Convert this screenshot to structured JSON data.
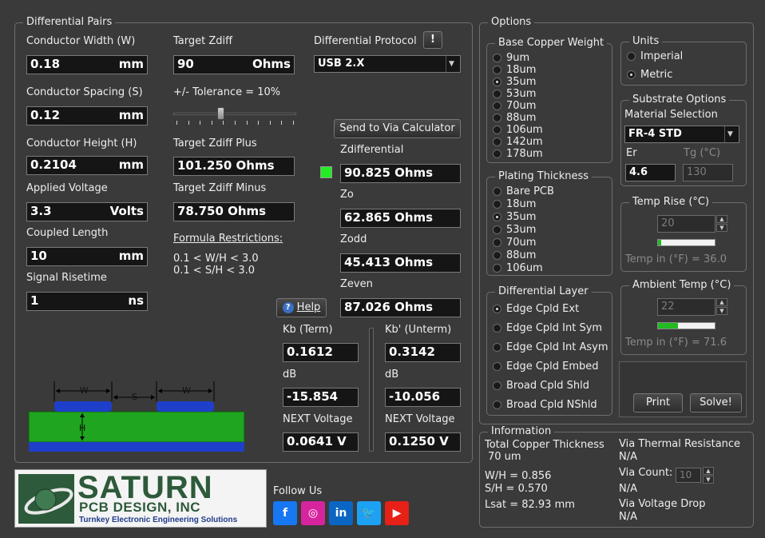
{
  "diff_pairs": {
    "title": "Differential Pairs",
    "conductor_width": {
      "label": "Conductor Width (W)",
      "value": "0.18",
      "unit": "mm"
    },
    "conductor_spacing": {
      "label": "Conductor Spacing (S)",
      "value": "0.12",
      "unit": "mm"
    },
    "conductor_height": {
      "label": "Conductor Height (H)",
      "value": "0.2104",
      "unit": "mm"
    },
    "applied_voltage": {
      "label": "Applied Voltage",
      "value": "3.3",
      "unit": "Volts"
    },
    "coupled_length": {
      "label": "Coupled Length",
      "value": "10",
      "unit": "mm"
    },
    "signal_risetime": {
      "label": "Signal Risetime",
      "value": "1",
      "unit": "ns"
    },
    "target_zdiff": {
      "label": "Target Zdiff",
      "value": "90",
      "unit": "Ohms"
    },
    "tolerance_label": "+/- Tolerance = 10%",
    "tolerance_value": 0.38,
    "target_zdiff_plus": {
      "label": "Target Zdiff Plus",
      "value": "101.250 Ohms"
    },
    "target_zdiff_minus": {
      "label": "Target Zdiff Minus",
      "value": "78.750 Ohms"
    },
    "formula_title": "Formula Restrictions:",
    "formula_line1": "0.1 < W/H < 3.0",
    "formula_line2": "0.1 < S/H < 3.0",
    "protocol_label": "Differential Protocol",
    "protocol_info": "!",
    "protocol_value": "USB 2.X",
    "send_via_label": "Send to Via Calculator",
    "zdifferential": {
      "label": "Zdifferential",
      "value": "90.825 Ohms"
    },
    "zo": {
      "label": "Zo",
      "value": "62.865 Ohms"
    },
    "zodd": {
      "label": "Zodd",
      "value": "45.413 Ohms"
    },
    "zeven": {
      "label": "Zeven",
      "value": "87.026 Ohms"
    },
    "help_label": "Help",
    "help_mark": "?",
    "kb_term": {
      "label": "Kb (Term)",
      "value": "0.1612",
      "db_label": "dB",
      "db": "-15.854",
      "next_label": "NEXT Voltage",
      "next": "0.0641 V"
    },
    "kb_unterm": {
      "label": "Kb' (Unterm)",
      "value": "0.3142",
      "db_label": "dB",
      "db": "-10.056",
      "next_label": "NEXT Voltage",
      "next": "0.1250 V"
    },
    "diagram": {
      "w1": "W",
      "s": "S",
      "w2": "W",
      "h": "H"
    },
    "status_color": "#22ee22"
  },
  "options": {
    "title": "Options",
    "base_copper": {
      "title": "Base Copper Weight",
      "items": [
        "9um",
        "18um",
        "35um",
        "53um",
        "70um",
        "88um",
        "106um",
        "142um",
        "178um"
      ],
      "selected": "35um"
    },
    "units": {
      "title": "Units",
      "items": [
        "Imperial",
        "Metric"
      ],
      "selected": "Metric"
    },
    "substrate": {
      "title": "Substrate Options",
      "material_label": "Material Selection",
      "material_value": "FR-4 STD",
      "er_label": "Er",
      "er_value": "4.6",
      "tg_label": "Tg (°C)",
      "tg_value": "130"
    },
    "plating": {
      "title": "Plating Thickness",
      "items": [
        "Bare PCB",
        "18um",
        "35um",
        "53um",
        "70um",
        "88um",
        "106um"
      ],
      "selected": "35um"
    },
    "temp_rise": {
      "title": "Temp Rise (°C)",
      "value": "20",
      "level": 0.05,
      "readout": "Temp in (°F) = 36.0"
    },
    "diff_layer": {
      "title": "Differential Layer",
      "items": [
        "Edge Cpld Ext",
        "Edge Cpld Int Sym",
        "Edge Cpld Int Asym",
        "Edge Cpld Embed",
        "Broad Cpld Shld",
        "Broad Cpld NShld"
      ],
      "selected": "Edge Cpld Ext"
    },
    "ambient_temp": {
      "title": "Ambient Temp (°C)",
      "value": "22",
      "level": 0.35,
      "readout": "Temp in (°F) = 71.6"
    },
    "print_label": "Print",
    "solve_label": "Solve!"
  },
  "information": {
    "title": "Information",
    "total_copper_label": "Total Copper Thickness",
    "total_copper_value": "70 um",
    "wh": "W/H =  0.856",
    "sh": "S/H =   0.570",
    "lsat": "Lsat =  82.93 mm",
    "via_thermal_label": "Via Thermal Resistance",
    "via_thermal_value": "N/A",
    "via_count_label": "Via Count:",
    "via_count_value": "10",
    "via_count_result": "N/A",
    "via_drop_label": "Via Voltage Drop",
    "via_drop_value": "N/A"
  },
  "branding": {
    "logo_big": "SATURN",
    "logo_sub": "PCB DESIGN, INC",
    "logo_tag": "Turnkey Electronic Engineering Solutions",
    "follow_us": "Follow Us",
    "socials": [
      {
        "name": "facebook",
        "glyph": "f",
        "color": "#1877f2"
      },
      {
        "name": "instagram",
        "glyph": "◎",
        "color": "#d6249f"
      },
      {
        "name": "linkedin",
        "glyph": "in",
        "color": "#0a66c2"
      },
      {
        "name": "twitter",
        "glyph": "🐦",
        "color": "#1da1f2"
      },
      {
        "name": "youtube",
        "glyph": "▶",
        "color": "#e62117"
      }
    ]
  }
}
